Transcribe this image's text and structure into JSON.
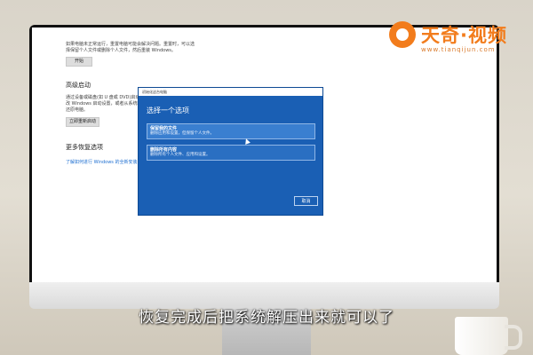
{
  "settings_page": {
    "recovery_text_line1": "如果电脑未正常运行，重置电脑可能会解决问题。重置时，可以选",
    "recovery_text_line2": "择保留个人文件或删除个人文件，然后重装 Windows。",
    "start_button": "开始",
    "advanced_startup_title": "高级启动",
    "advanced_text_line1": "通过设备或磁盘(如 U 盘或 DVD)启动，更",
    "advanced_text_line2": "改 Windows 启动设置，或者从系统映像中",
    "advanced_text_line3": "还原电脑。",
    "restart_now_button": "立即重新启动",
    "more_options_title": "更多恢复选项",
    "more_options_link": "了解如何进行 Windows 的全新安装以便开..."
  },
  "dialog": {
    "titlebar": "初始化这台电脑",
    "heading": "选择一个选项",
    "options": [
      {
        "title": "保留我的文件",
        "desc": "删除应用和设置，但保留个人文件。"
      },
      {
        "title": "删除所有内容",
        "desc": "删除所有个人文件、应用和设置。"
      }
    ],
    "cancel": "取消"
  },
  "logo": {
    "name": "天奇·视频",
    "url": "www.tianqijun.com"
  },
  "subtitle": "恢复完成后把系统解压出来就可以了",
  "colors": {
    "dialog_bg": "#1a5fb4",
    "brand": "#f27c1c",
    "link": "#1e6fd1"
  }
}
